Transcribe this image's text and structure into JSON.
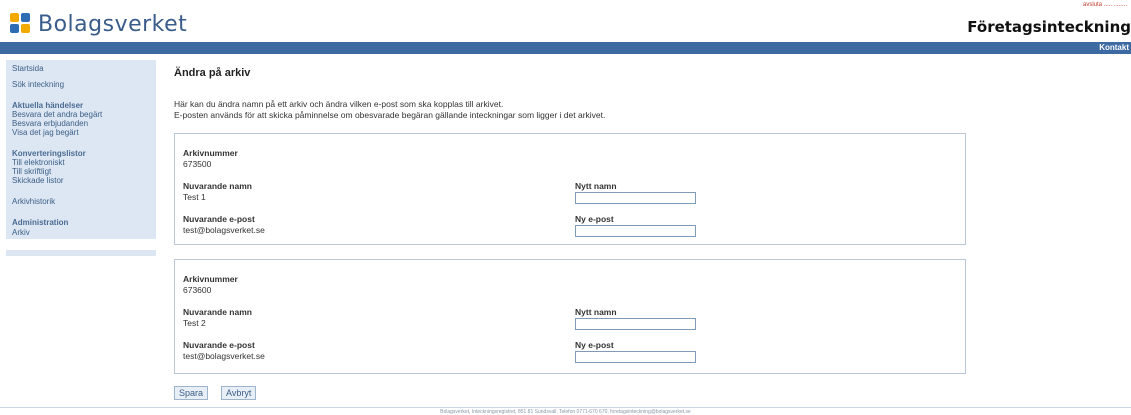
{
  "header": {
    "logo_text": "Bolagsverket",
    "service_title": "Företagsinteckning",
    "top_links": "avsluta ..... ........",
    "brand_colors": {
      "gold": "#f2a900",
      "blue": "#2e6db4",
      "navbar": "#3d6aa3"
    }
  },
  "navbar": {
    "link": "Kontakt"
  },
  "sidebar": {
    "items": [
      {
        "label": "Startsida",
        "heading": false,
        "active": false
      },
      {
        "label": "Sök inteckning",
        "heading": false,
        "active": false
      },
      {
        "label": "Aktuella händelser",
        "heading": true,
        "active": false
      },
      {
        "label": "Besvara det andra begärt",
        "heading": false,
        "active": false
      },
      {
        "label": "Besvara erbjudanden",
        "heading": false,
        "active": false
      },
      {
        "label": "Visa det jag begärt",
        "heading": false,
        "active": false
      },
      {
        "label": "Konverteringslistor",
        "heading": true,
        "active": false
      },
      {
        "label": "Till elektroniskt",
        "heading": false,
        "active": false
      },
      {
        "label": "Till skriftligt",
        "heading": false,
        "active": false
      },
      {
        "label": "Skickade listor",
        "heading": false,
        "active": false
      },
      {
        "label": "Arkivhistorik",
        "heading": false,
        "active": false
      },
      {
        "label": "Administration",
        "heading": true,
        "active": false
      },
      {
        "label": "Arkiv",
        "heading": false,
        "active": true
      }
    ]
  },
  "main": {
    "title": "Ändra på arkiv",
    "intro_1": "Här kan du ändra namn på ett arkiv och ändra vilken e-post som ska kopplas till arkivet.",
    "intro_2": "E-posten används för att skicka påminnelse om obesvarade begäran gällande inteckningar som ligger i det arkivet.",
    "archives": [
      {
        "number_label": "Arkivnummer",
        "number": "673500",
        "current_name_label": "Nuvarande namn",
        "current_name": "Test 1",
        "new_name_label": "Nytt namn",
        "new_name_value": "",
        "current_email_label": "Nuvarande e-post",
        "current_email": "test@bolagsverket.se",
        "new_email_label": "Ny e-post",
        "new_email_value": ""
      },
      {
        "number_label": "Arkivnummer",
        "number": "673600",
        "current_name_label": "Nuvarande namn",
        "current_name": "Test 2",
        "new_name_label": "Nytt namn",
        "new_name_value": "",
        "current_email_label": "Nuvarande e-post",
        "current_email": "test@bolagsverket.se",
        "new_email_label": "Ny e-post",
        "new_email_value": ""
      }
    ]
  },
  "buttons": {
    "save": "Spara",
    "cancel": "Avbryt"
  },
  "footer": "Bolagsverket, Inteckningsregistret, 851 81 Sundsvall, Telefon 0771-670 670, foretagsinteckning@bolagsverket.se"
}
